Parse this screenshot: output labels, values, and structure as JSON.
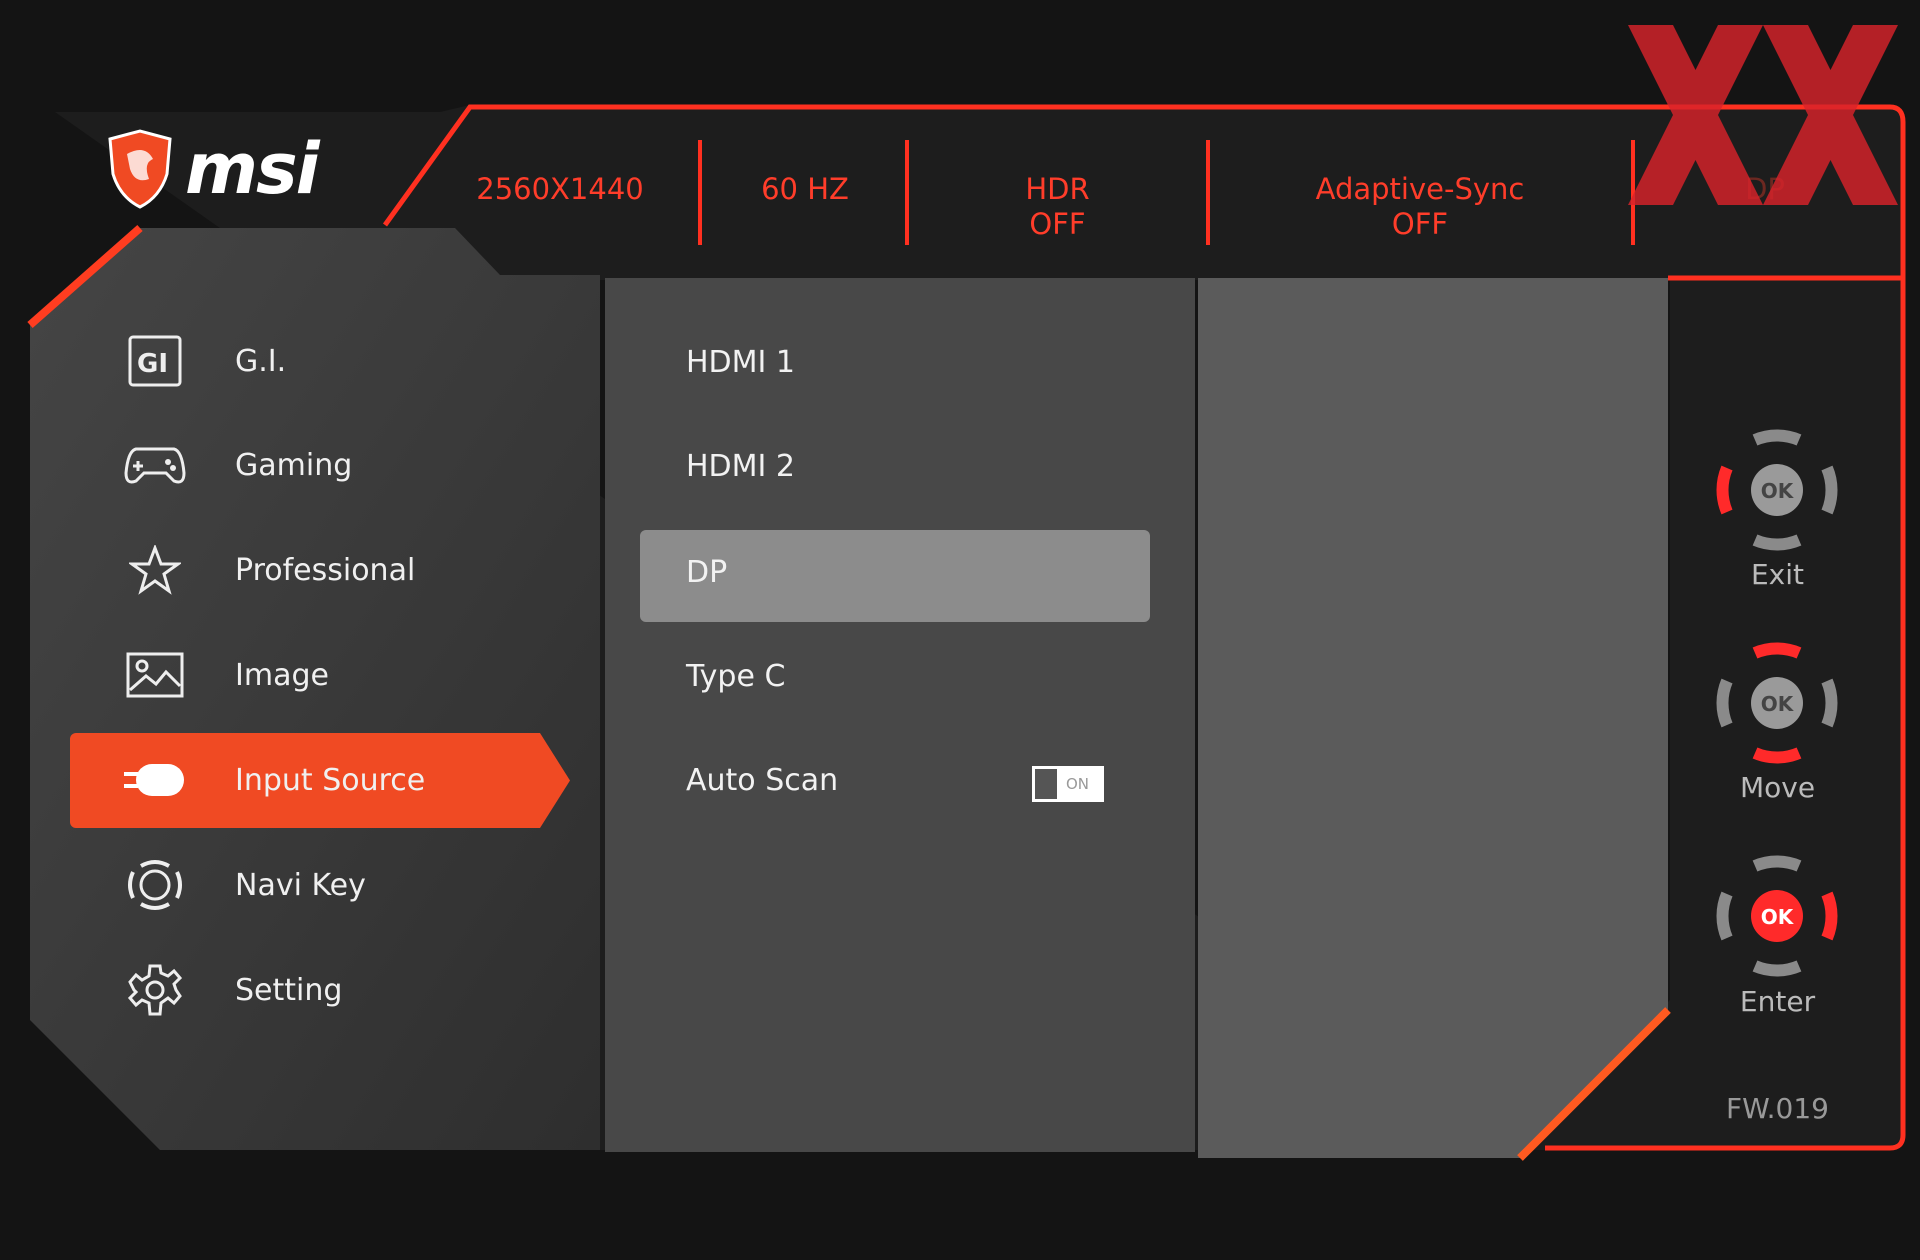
{
  "brand": {
    "name": "msi"
  },
  "status_bar": {
    "resolution": "2560X1440",
    "refresh": "60 HZ",
    "hdr": {
      "label": "HDR",
      "value": "OFF"
    },
    "adaptive_sync": {
      "label": "Adaptive-Sync",
      "value": "OFF"
    },
    "input": "DP"
  },
  "menu": {
    "items": [
      {
        "label": "G.I.",
        "icon": "gi-icon"
      },
      {
        "label": "Gaming",
        "icon": "gamepad-icon"
      },
      {
        "label": "Professional",
        "icon": "star-icon"
      },
      {
        "label": "Image",
        "icon": "image-icon"
      },
      {
        "label": "Input Source",
        "icon": "input-icon",
        "selected": true
      },
      {
        "label": "Navi Key",
        "icon": "navi-key-icon"
      },
      {
        "label": "Setting",
        "icon": "gear-icon"
      }
    ]
  },
  "submenu": {
    "items": [
      "HDMI 1",
      "HDMI 2",
      "DP",
      "Type C"
    ],
    "selected": "DP",
    "auto_scan": {
      "label": "Auto Scan",
      "toggle_label": "ON",
      "state": "on"
    }
  },
  "navkeys": {
    "exit": "Exit",
    "move": "Move",
    "enter": "Enter",
    "ok": "OK"
  },
  "firmware": "FW.019",
  "colors": {
    "accent": "#f04a23",
    "border": "#ff3020",
    "panel": "#3c3c3c"
  }
}
